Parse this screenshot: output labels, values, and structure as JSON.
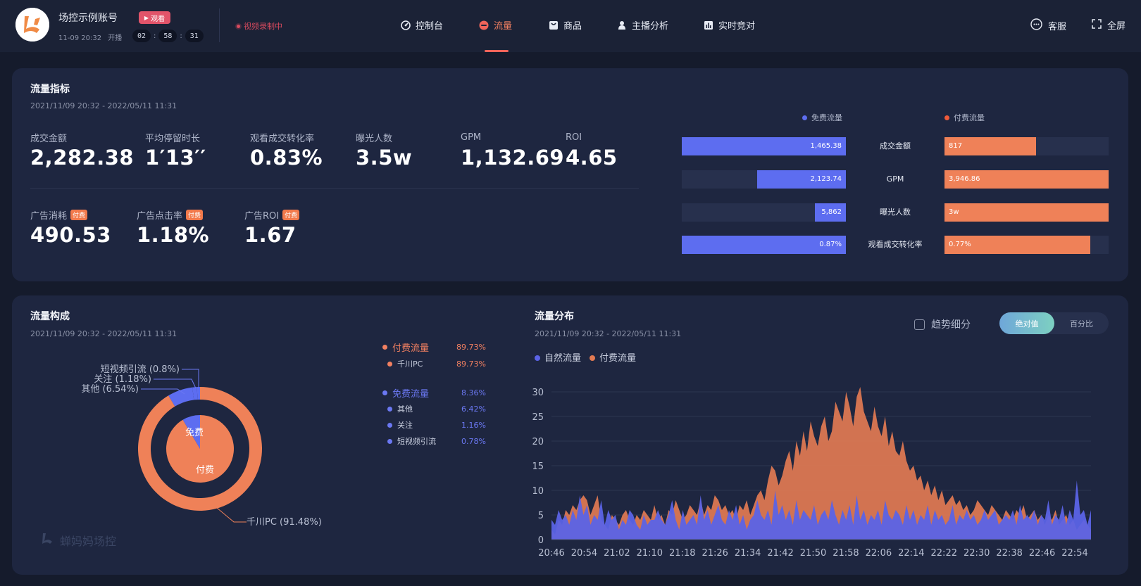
{
  "header": {
    "account_name": "场控示例账号",
    "start_time": "11-09 20:32",
    "start_label": "开播",
    "watch_badge": "观看",
    "timer": [
      "02",
      "58",
      "31"
    ],
    "timer_sep": ":",
    "recording": "视频录制中",
    "nav": [
      {
        "label": "控制台",
        "icon": "dashboard-icon",
        "active": false
      },
      {
        "label": "流量",
        "icon": "traffic-icon",
        "active": true
      },
      {
        "label": "商品",
        "icon": "goods-icon",
        "active": false
      },
      {
        "label": "主播分析",
        "icon": "anchor-icon",
        "active": false
      },
      {
        "label": "实时竞对",
        "icon": "bar-chart-icon",
        "active": false
      }
    ],
    "service": "客服",
    "fullscreen": "全屏"
  },
  "traffic_metrics": {
    "title": "流量指标",
    "date_range": "2021/11/09 20:32 - 2022/05/11 11:31",
    "metrics": [
      {
        "label": "成交金额",
        "value": "2,282.38"
      },
      {
        "label": "平均停留时长",
        "value": "1′13′′"
      },
      {
        "label": "观看成交转化率",
        "value": "0.83%"
      },
      {
        "label": "曝光人数",
        "value": "3.5w"
      },
      {
        "label": "GPM",
        "value": "1,132.69"
      },
      {
        "label": "ROI",
        "value": "4.65"
      }
    ],
    "ad_metrics": [
      {
        "label": "广告消耗",
        "tag": "付费",
        "value": "490.53"
      },
      {
        "label": "广告点击率",
        "tag": "付费",
        "value": "1.18%"
      },
      {
        "label": "广告ROI",
        "tag": "付费",
        "value": "1.67"
      }
    ],
    "comparison": {
      "free_label": "免费流量",
      "paid_label": "付费流量",
      "free_color": "#5d6df0",
      "paid_color": "#ef8158",
      "rows": [
        {
          "label": "成交金额",
          "free": "1,465.38",
          "free_ratio": 1.0,
          "paid": "817",
          "paid_ratio": 0.56
        },
        {
          "label": "GPM",
          "free": "2,123.74",
          "free_ratio": 0.54,
          "paid": "3,946.86",
          "paid_ratio": 1.0
        },
        {
          "label": "曝光人数",
          "free": "5,862",
          "free_ratio": 0.19,
          "paid": "3w",
          "paid_ratio": 1.0
        },
        {
          "label": "观看成交转化率",
          "free": "0.87%",
          "free_ratio": 1.0,
          "paid": "0.77%",
          "paid_ratio": 0.89
        }
      ]
    }
  },
  "traffic_composition": {
    "title": "流量构成",
    "date_range": "2021/11/09 20:32 - 2022/05/11 11:31",
    "inner_labels": {
      "free": "免费",
      "paid": "付费"
    },
    "outer_labels": [
      {
        "text": "短视频引流 (0.8%)"
      },
      {
        "text": "关注 (1.18%)"
      },
      {
        "text": "其他 (6.54%)"
      },
      {
        "text": "千川PC (91.48%)"
      }
    ],
    "legend": [
      {
        "label": "付费流量",
        "value": "89.73%",
        "group": "paid",
        "level": 0
      },
      {
        "label": "千川PC",
        "value": "89.73%",
        "group": "paid",
        "level": 1
      },
      {
        "label": "免费流量",
        "value": "8.36%",
        "group": "free",
        "level": 0
      },
      {
        "label": "其他",
        "value": "6.42%",
        "group": "free",
        "level": 1
      },
      {
        "label": "关注",
        "value": "1.16%",
        "group": "free",
        "level": 1
      },
      {
        "label": "短视频引流",
        "value": "0.78%",
        "group": "free",
        "level": 1
      }
    ],
    "watermark": "蝉妈妈场控"
  },
  "traffic_distribution": {
    "title": "流量分布",
    "date_range": "2021/11/09 20:32 - 2022/05/11 11:31",
    "trend_checkbox": "趋势细分",
    "segments": [
      "绝对值",
      "百分比"
    ],
    "active_segment": "绝对值"
  },
  "chart_data": [
    {
      "type": "pie",
      "title": "流量构成",
      "inner": [
        {
          "name": "免费",
          "value": 8.36
        },
        {
          "name": "付费",
          "value": 89.73
        }
      ],
      "outer": [
        {
          "name": "短视频引流",
          "value": 0.8
        },
        {
          "name": "关注",
          "value": 1.18
        },
        {
          "name": "其他",
          "value": 6.54
        },
        {
          "name": "千川PC",
          "value": 91.48
        }
      ]
    },
    {
      "type": "area",
      "title": "流量分布",
      "ylim": [
        0,
        30
      ],
      "yticks": [
        0,
        5,
        10,
        15,
        20,
        25,
        30
      ],
      "xtick_labels": [
        "20:46",
        "20:54",
        "21:02",
        "21:10",
        "21:18",
        "21:26",
        "21:34",
        "21:42",
        "21:50",
        "21:58",
        "22:06",
        "22:14",
        "22:22",
        "22:30",
        "22:38",
        "22:46",
        "22:54"
      ],
      "series": [
        {
          "name": "自然流量",
          "color": "#5b63e6",
          "values": [
            4,
            3,
            6,
            4,
            5,
            3,
            6,
            4,
            9,
            5,
            7,
            3,
            5,
            4,
            8,
            3,
            6,
            4,
            5,
            2,
            4,
            3,
            6,
            5,
            3,
            2,
            5,
            3,
            4,
            4,
            6,
            4,
            3,
            5,
            8,
            4,
            2,
            6,
            3,
            4,
            5,
            3,
            9,
            4,
            6,
            3,
            5,
            7,
            4,
            3,
            6,
            4,
            7,
            3,
            5,
            2,
            4,
            5,
            8,
            5,
            4,
            6,
            3,
            10,
            5,
            7,
            4,
            6,
            3,
            8,
            4,
            6,
            5,
            4,
            7,
            3,
            5,
            6,
            4,
            8,
            5,
            3,
            6,
            4,
            7,
            3,
            9,
            4,
            6,
            3,
            5,
            4,
            6,
            3,
            8,
            5,
            4,
            6,
            5,
            3,
            7,
            4,
            6,
            3,
            5,
            4,
            7,
            3,
            6,
            4,
            5,
            3,
            4,
            7,
            3,
            5,
            4,
            6,
            4,
            5,
            3,
            4,
            6,
            4,
            5,
            6,
            3,
            4,
            5,
            4,
            6,
            3,
            7,
            4,
            5,
            4,
            6,
            3,
            5,
            4,
            8,
            3,
            5,
            4,
            7,
            3,
            6,
            4,
            12,
            5,
            6,
            3,
            6
          ]
        },
        {
          "name": "付费流量",
          "color": "#e27a52",
          "values": [
            2,
            1,
            4,
            3,
            6,
            5,
            7,
            6,
            8,
            9,
            8,
            5,
            7,
            9,
            4,
            3,
            2,
            5,
            4,
            3,
            5,
            6,
            4,
            3,
            5,
            4,
            6,
            5,
            4,
            7,
            4,
            5,
            3,
            6,
            5,
            8,
            6,
            4,
            5,
            7,
            6,
            5,
            8,
            5,
            7,
            6,
            9,
            8,
            6,
            7,
            5,
            6,
            4,
            7,
            6,
            8,
            5,
            7,
            9,
            10,
            8,
            12,
            15,
            14,
            11,
            13,
            16,
            18,
            14,
            20,
            17,
            22,
            18,
            24,
            21,
            19,
            23,
            25,
            20,
            22,
            28,
            26,
            24,
            30,
            27,
            23,
            29,
            31,
            26,
            24,
            22,
            27,
            23,
            21,
            25,
            19,
            22,
            18,
            17,
            20,
            16,
            14,
            15,
            12,
            13,
            10,
            12,
            9,
            11,
            8,
            10,
            7,
            8,
            9,
            7,
            8,
            6,
            7,
            5,
            6,
            8,
            7,
            6,
            5,
            7,
            6,
            5,
            4,
            6,
            5,
            4,
            6,
            5,
            7,
            4,
            5,
            6,
            4,
            5,
            3,
            5,
            4,
            6,
            3,
            4,
            5,
            3,
            4,
            2,
            3,
            4,
            3,
            2
          ]
        }
      ]
    }
  ]
}
